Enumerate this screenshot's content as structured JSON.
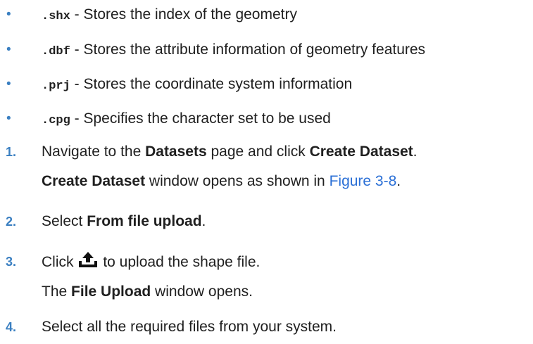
{
  "bullets": [
    {
      "marker": "•",
      "code": ".shx",
      "text": " - Stores the index of the geometry"
    },
    {
      "marker": "•",
      "code": ".dbf",
      "text": " - Stores the attribute information of geometry features"
    },
    {
      "marker": "•",
      "code": ".prj",
      "text": " - Stores the coordinate system information"
    },
    {
      "marker": "•",
      "code": ".cpg",
      "text": " - Specifies the character set to be used"
    }
  ],
  "steps": [
    {
      "number": "1.",
      "parts": [
        "Navigate to the ",
        "Datasets",
        " page and click ",
        "Create Dataset",
        "."
      ],
      "followup": {
        "bold": "Create Dataset",
        "text": " window opens as shown in ",
        "link": "Figure 3-8",
        "end": "."
      }
    },
    {
      "number": "2.",
      "parts": [
        "Select ",
        "From file upload",
        "."
      ]
    },
    {
      "number": "3.",
      "before": "Click",
      "icon": "upload-icon",
      "after": " to upload the shape file.",
      "followup": {
        "pre": "The ",
        "bold": "File Upload",
        "text": " window opens."
      }
    },
    {
      "number": "4.",
      "text": "Select all the required files from your system."
    }
  ]
}
